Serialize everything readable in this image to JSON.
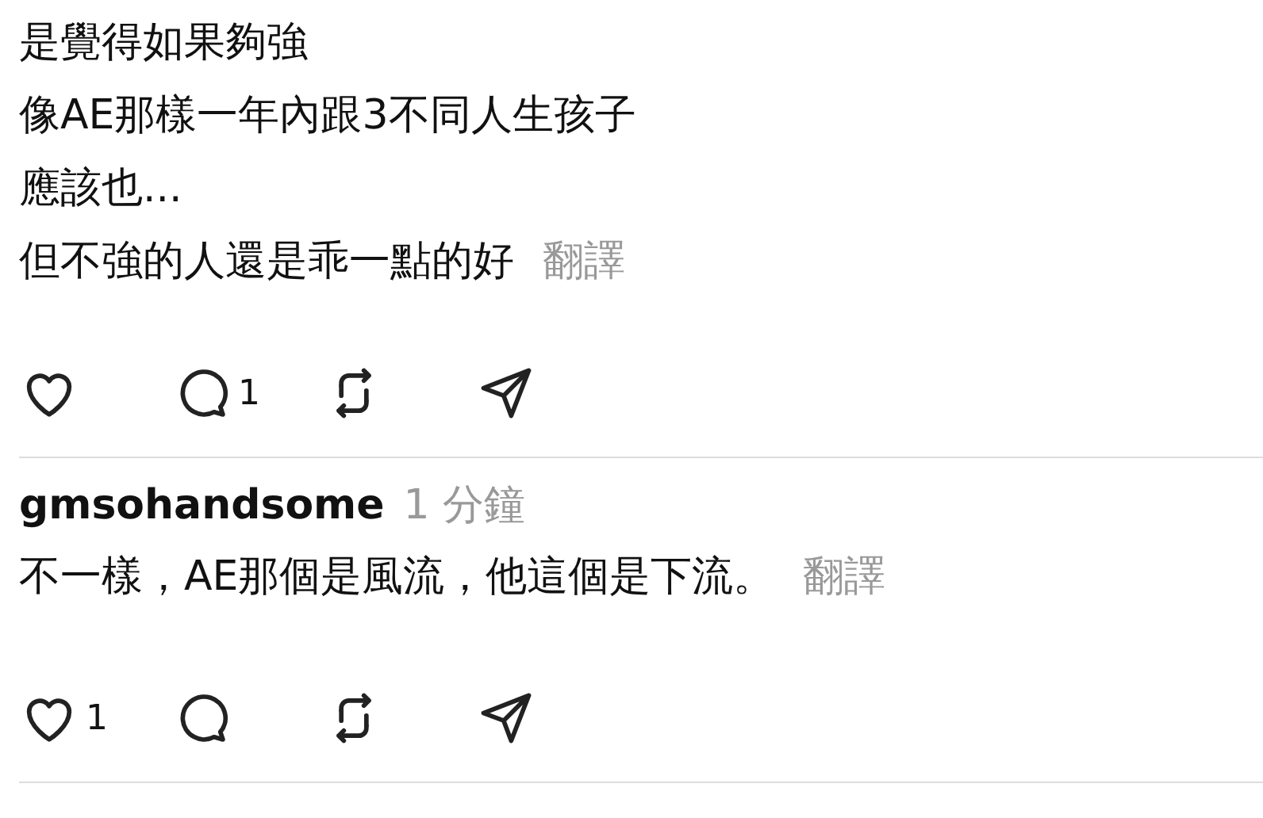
{
  "post": {
    "lines": [
      "是覺得如果夠強",
      "像AE那樣一年內跟3不同人生孩子",
      "應該也...",
      "但不強的人還是乖一點的好"
    ],
    "translate": "翻譯",
    "actions": [
      {
        "kind": "like"
      },
      {
        "kind": "comment",
        "count": "1"
      },
      {
        "kind": "repost"
      },
      {
        "kind": "share"
      }
    ]
  },
  "reply": {
    "username": "gmsohandsome",
    "time": "1 分鐘",
    "text": "不一樣，AE那個是風流，他這個是下流。",
    "translate": "翻譯",
    "actions": [
      {
        "kind": "like",
        "count": "1"
      },
      {
        "kind": "comment"
      },
      {
        "kind": "repost"
      },
      {
        "kind": "share"
      }
    ]
  }
}
